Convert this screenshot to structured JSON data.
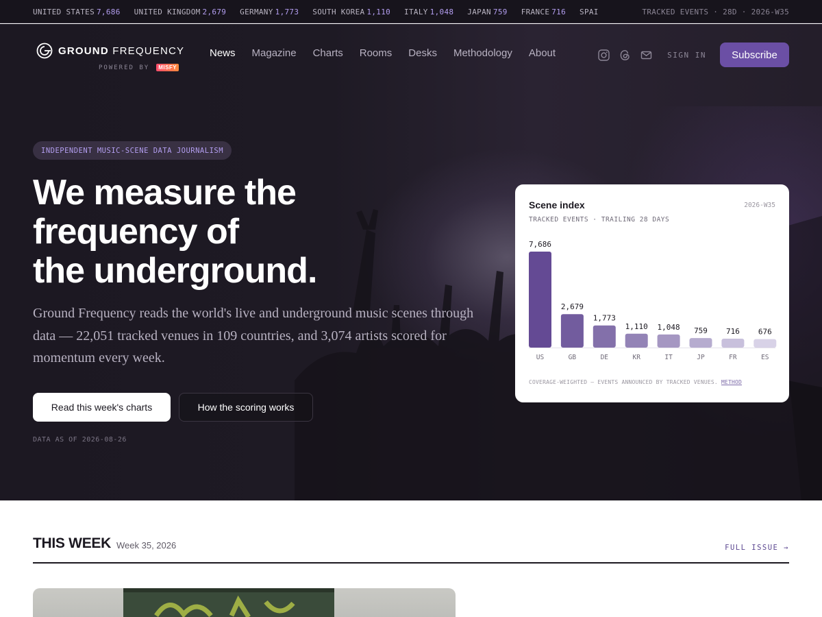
{
  "ticker": {
    "items": [
      {
        "country": "UNITED STATES",
        "value": "7,686"
      },
      {
        "country": "UNITED KINGDOM",
        "value": "2,679"
      },
      {
        "country": "GERMANY",
        "value": "1,773"
      },
      {
        "country": "SOUTH KOREA",
        "value": "1,110"
      },
      {
        "country": "ITALY",
        "value": "1,048"
      },
      {
        "country": "JAPAN",
        "value": "759"
      },
      {
        "country": "FRANCE",
        "value": "716"
      },
      {
        "country": "SPAI",
        "value": ""
      }
    ],
    "meta": "TRACKED EVENTS · 28D · 2026-W35"
  },
  "brand": {
    "name_bold": "GROUND",
    "name_light": " FREQUENCY",
    "powered_by": "POWERED BY",
    "partner": "MISFY"
  },
  "nav": {
    "items": [
      "News",
      "Magazine",
      "Charts",
      "Rooms",
      "Desks",
      "Methodology",
      "About"
    ],
    "active": "News",
    "social_icons": [
      "instagram-icon",
      "threads-icon",
      "mail-icon"
    ],
    "sign_in": "SIGN IN",
    "subscribe": "Subscribe"
  },
  "hero": {
    "eyebrow": "INDEPENDENT MUSIC-SCENE DATA JOURNALISM",
    "headline_lines": [
      "We measure the",
      "frequency of",
      "the underground."
    ],
    "lede": "Ground Frequency reads the world's live and underground music scenes through data — 22,051 tracked venues in 109 countries, and 3,074 artists scored for momentum every week.",
    "cta_primary": "Read this week's charts",
    "cta_secondary": "How the scoring works",
    "data_as_of": "DATA AS OF 2026-08-26"
  },
  "scene_card": {
    "title": "Scene index",
    "week": "2026-W35",
    "subtitle": "TRACKED EVENTS · TRAILING 28 DAYS",
    "footnote": "COVERAGE-WEIGHTED — EVENTS ANNOUNCED BY TRACKED VENUES.",
    "footnote_link": "METHOD"
  },
  "chart_data": {
    "type": "bar",
    "categories": [
      "US",
      "GB",
      "DE",
      "KR",
      "IT",
      "JP",
      "FR",
      "ES"
    ],
    "values": [
      7686,
      2679,
      1773,
      1110,
      1048,
      759,
      716,
      676
    ],
    "value_labels": [
      "7,686",
      "2,679",
      "1,773",
      "1,110",
      "1,048",
      "759",
      "716",
      "676"
    ],
    "title": "Scene index",
    "xlabel": "",
    "ylabel": "",
    "grid": false,
    "bar_colors": [
      "#644a94",
      "#725c9e",
      "#8370aa",
      "#9383b6",
      "#a597c2",
      "#b6accf",
      "#c8c0dc",
      "#d8d2e7"
    ]
  },
  "this_week": {
    "title": "THIS WEEK",
    "subtitle": "Week 35, 2026",
    "full_issue": "FULL ISSUE →"
  }
}
